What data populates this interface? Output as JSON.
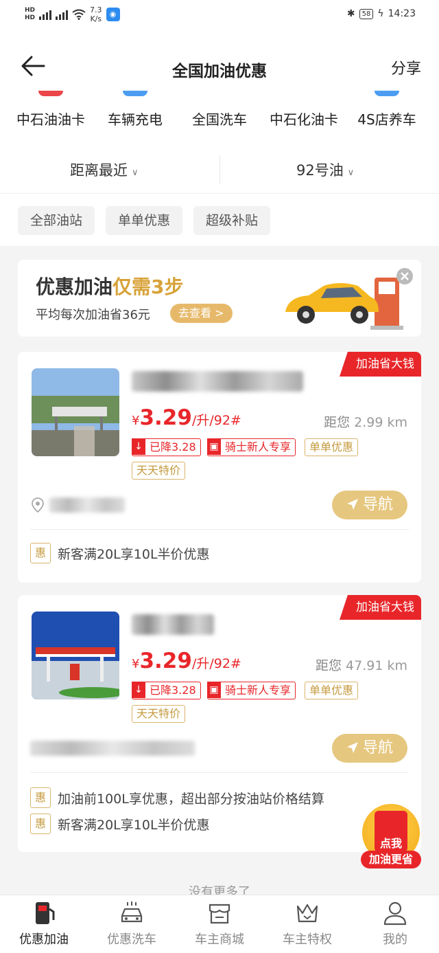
{
  "status_bar": {
    "speed": "7.3",
    "speed_unit": "K/s",
    "battery": "58",
    "time": "14:23"
  },
  "header": {
    "title": "全国加油优惠",
    "share_label": "分享"
  },
  "quick_links": [
    {
      "label": "中石油油卡",
      "color": "#e8262a"
    },
    {
      "label": "车辆充电",
      "color": "#2d8cf0"
    },
    {
      "label": "全国洗车",
      "color": "#ffffff"
    },
    {
      "label": "中石化油卡",
      "color": "#ffffff"
    },
    {
      "label": "4S店养车",
      "color": "#2d8cf0"
    }
  ],
  "sort": {
    "distance_label": "距离最近",
    "fuel_label": "92号油"
  },
  "filters": [
    "全部油站",
    "单单优惠",
    "超级补贴"
  ],
  "banner": {
    "title_main": "优惠加油",
    "title_highlight": "仅需3步",
    "subtitle": "平均每次加油省36元",
    "button": "去查看 >"
  },
  "stations": [
    {
      "corner_tag": "加油省大钱",
      "price_symbol": "¥",
      "price": "3.29",
      "price_unit": "/升/92#",
      "distance_label": "距您",
      "distance": "2.99 km",
      "tags": {
        "drop": "已降3.28",
        "new_rider": "骑士新人专享",
        "every": "单单优惠",
        "daily": "天天特价"
      },
      "nav_label": "导航",
      "perks": [
        "新客满20L享10L半价优惠"
      ]
    },
    {
      "corner_tag": "加油省大钱",
      "price_symbol": "¥",
      "price": "3.29",
      "price_unit": "/升/92#",
      "distance_label": "距您",
      "distance": "47.91 km",
      "tags": {
        "drop": "已降3.28",
        "new_rider": "骑士新人专享",
        "every": "单单优惠",
        "daily": "天天特价"
      },
      "nav_label": "导航",
      "perks": [
        "加油前100L享优惠，超出部分按油站价格结算",
        "新客满20L享10L半价优惠"
      ]
    }
  ],
  "perk_badge": "惠",
  "footer_text": "没有更多了",
  "floating_promo": {
    "line1": "点我",
    "line2": "加油更省"
  },
  "tabs": [
    "优惠加油",
    "优惠洗车",
    "车主商城",
    "车主特权",
    "我的"
  ],
  "colors": {
    "accent_red": "#e8262a",
    "gold": "#d9b46c"
  }
}
